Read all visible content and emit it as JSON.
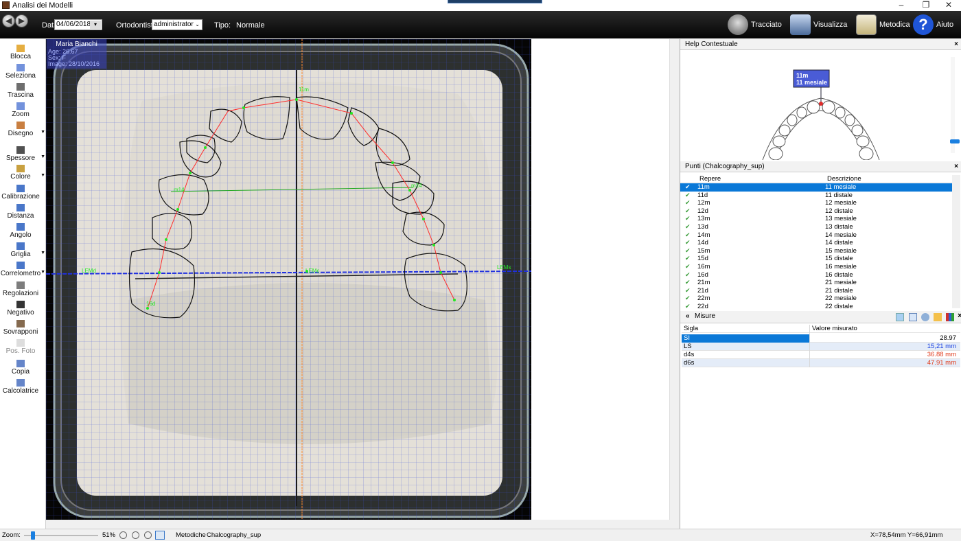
{
  "window": {
    "title": "Analisi dei Modelli",
    "controls": [
      "–",
      "❐",
      "✕"
    ]
  },
  "header": {
    "date_label": "Data:",
    "date_value": "04/06/2018",
    "ortho_label": "Ortodontista:",
    "ortho_value": "administrator",
    "type_label": "Tipo:",
    "type_value": "Normale",
    "buttons": [
      {
        "label": "Tracciato",
        "icon": "tracing-icon"
      },
      {
        "label": "Visualizza",
        "icon": "view-icon"
      },
      {
        "label": "Metodica",
        "icon": "clipboard-icon"
      },
      {
        "label": "Aiuto",
        "icon": "help-icon"
      }
    ]
  },
  "toolbar": {
    "tools": [
      {
        "label": "Blocca",
        "icon": "lock-icon",
        "dis": false
      },
      {
        "label": "Seleziona",
        "icon": "cursor-icon",
        "dis": false
      },
      {
        "label": "Trascina",
        "icon": "hand-icon",
        "dis": false
      },
      {
        "label": "Zoom",
        "icon": "zoom-icon",
        "dis": false
      },
      {
        "label": "Disegno",
        "icon": "pencil-icon",
        "dis": false
      },
      {
        "label": "Spessore",
        "icon": "line-width-icon",
        "dis": false
      },
      {
        "label": "Colore",
        "icon": "color-icon",
        "dis": false
      },
      {
        "label": "Calibrazione",
        "icon": "calibration-icon",
        "dis": false
      },
      {
        "label": "Distanza",
        "icon": "distance-icon",
        "dis": false
      },
      {
        "label": "Angolo",
        "icon": "angle-icon",
        "dis": false
      },
      {
        "label": "Griglia",
        "icon": "grid-icon",
        "dis": false
      },
      {
        "label": "Correlometro",
        "icon": "correlometer-icon",
        "dis": false
      },
      {
        "label": "Regolazioni",
        "icon": "adjust-icon",
        "dis": false
      },
      {
        "label": "Negativo",
        "icon": "negative-icon",
        "dis": false
      },
      {
        "label": "Sovrapponi",
        "icon": "overlay-icon",
        "dis": false
      },
      {
        "label": "Pos. Foto",
        "icon": "photo-pos-icon",
        "dis": true
      },
      {
        "label": "Copia",
        "icon": "copy-icon",
        "dis": false
      },
      {
        "label": "Calcolatrice",
        "icon": "calculator-icon",
        "dis": false
      }
    ]
  },
  "patient": {
    "name": "Maria Bianchi",
    "age": "Age: 26.67",
    "sex": "Sex: F",
    "image": "Image: 28/10/2016"
  },
  "canvas_labels": {
    "lemd": "LEMd",
    "lems": "LEMs",
    "lemc": "LEMc",
    "m14": "m14",
    "m24": "m24",
    "d16": "16d",
    "tooth_11": "11m"
  },
  "help": {
    "title": "Help Contestuale",
    "tooltip_line1": "11m",
    "tooltip_line2": "11 mesiale"
  },
  "punti": {
    "title": "Punti  (Chalcography_sup)",
    "col_repere": "Repere",
    "col_descr": "Descrizione",
    "rows": [
      {
        "r": "11m",
        "d": "11 mesiale"
      },
      {
        "r": "11d",
        "d": "11 distale"
      },
      {
        "r": "12m",
        "d": "12 mesiale"
      },
      {
        "r": "12d",
        "d": "12 distale"
      },
      {
        "r": "13m",
        "d": "13 mesiale"
      },
      {
        "r": "13d",
        "d": "13 distale"
      },
      {
        "r": "14m",
        "d": "14 mesiale"
      },
      {
        "r": "14d",
        "d": "14 distale"
      },
      {
        "r": "15m",
        "d": "15 mesiale"
      },
      {
        "r": "15d",
        "d": "15 distale"
      },
      {
        "r": "16m",
        "d": "16 mesiale"
      },
      {
        "r": "16d",
        "d": "16 distale"
      },
      {
        "r": "21m",
        "d": "21 mesiale"
      },
      {
        "r": "21d",
        "d": "21 distale"
      },
      {
        "r": "22m",
        "d": "22 mesiale"
      },
      {
        "r": "22d",
        "d": "22 distale"
      }
    ]
  },
  "misure": {
    "title": "Misure",
    "collapse": "«",
    "col_sigla": "Sigla",
    "col_valore": "Valore misurato",
    "rows": [
      {
        "s": "SI",
        "v": "28.97",
        "color": "#000000"
      },
      {
        "s": "LS",
        "v": "15,21 mm",
        "color": "#1a40e0"
      },
      {
        "s": "d4s",
        "v": "36.88 mm",
        "color": "#e03a1a"
      },
      {
        "s": "d6s",
        "v": "47.91 mm",
        "color": "#e03a1a"
      }
    ]
  },
  "status": {
    "zoom_label": "Zoom:",
    "zoom_value": "51%",
    "zoom_level": 0.51,
    "metodiche_label": "Metodiche",
    "metodiche_value": "Chalcography_sup",
    "coords": "X=78,54mm Y=66,91mm"
  },
  "colors": {
    "accent": "#0a78d7",
    "green_marker": "#22e822",
    "red_line": "#ff2a2a",
    "grid": "#3a4fd8"
  }
}
